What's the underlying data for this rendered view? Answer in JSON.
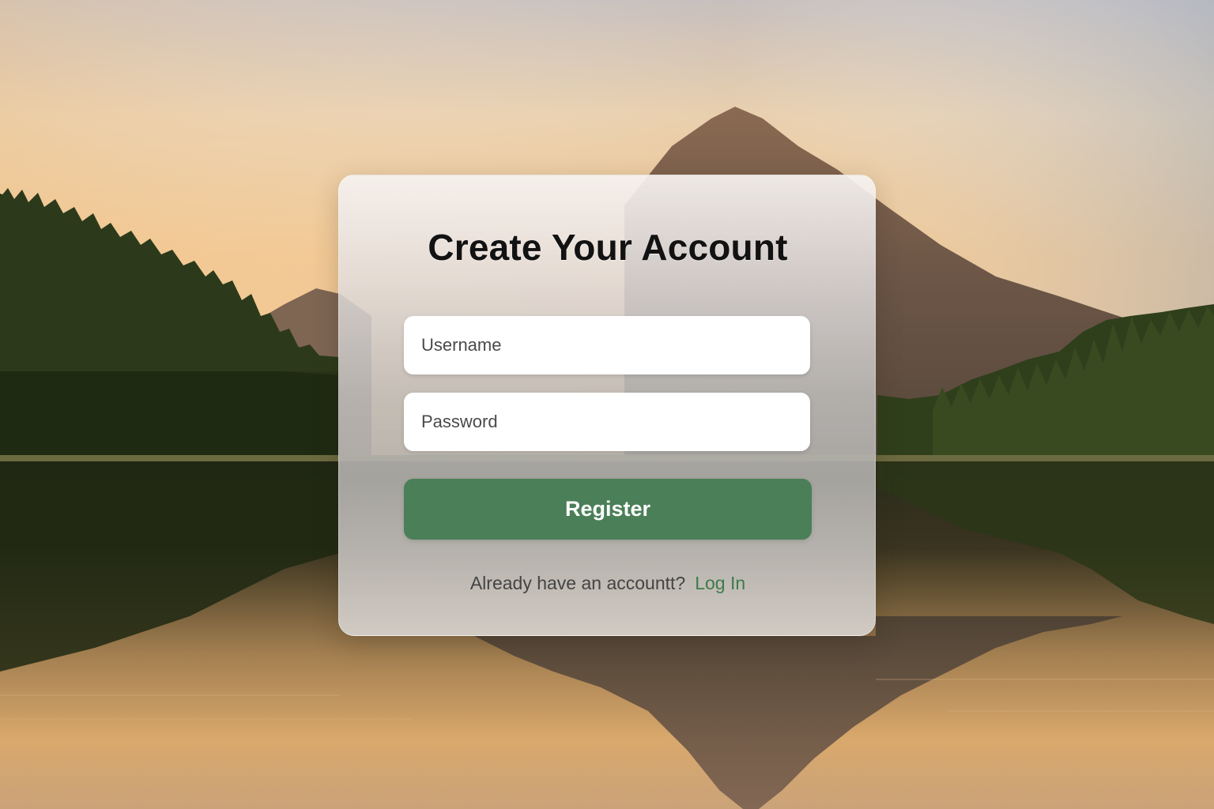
{
  "form": {
    "title": "Create Your Account",
    "username_placeholder": "Username",
    "password_placeholder": "Password",
    "register_label": "Register",
    "login_prompt": "Already have an accountt?",
    "login_link": "Log In"
  },
  "colors": {
    "accent": "#4a7f57",
    "link": "#3e7a4c",
    "title": "#121212"
  }
}
